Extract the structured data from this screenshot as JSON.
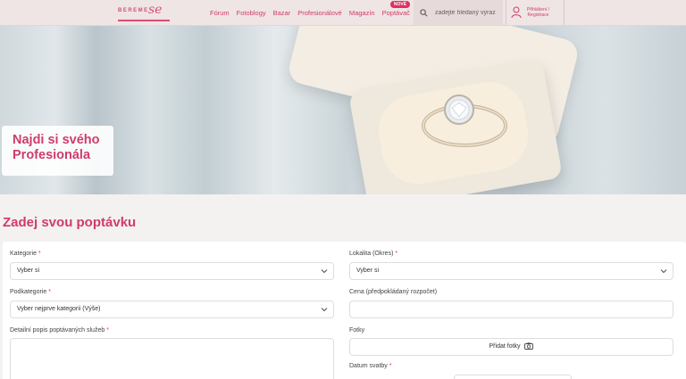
{
  "header": {
    "logo_text": "BEREME",
    "logo_script": "se",
    "nav": [
      "Fórum",
      "Fotoblogy",
      "Bazar",
      "Profesionálové",
      "Magazín",
      "Poptávač"
    ],
    "new_badge": "NOVÉ",
    "search_placeholder": "zadejte hledaný výraz",
    "login_line1": "Přihlášení /",
    "login_line2": "Registrace"
  },
  "hero": {
    "title_line1": "Najdi si svého",
    "title_line2": "Profesionála"
  },
  "form": {
    "title": "Zadej svou poptávku",
    "category": {
      "label": "Kategorie",
      "value": "Vyber si"
    },
    "location": {
      "label": "Lokalita (Okres)",
      "value": "Vyber si"
    },
    "subcategory": {
      "label": "Podkategorie",
      "value": "Vyber nejprve kategorii (Výše)"
    },
    "price": {
      "label": "Cena (předpokládaný rozpočet)",
      "value": ""
    },
    "description": {
      "label": "Detailní popis poptávaných služeb"
    },
    "photos": {
      "label": "Fotky",
      "button": "Přidat fotky"
    },
    "wedding_date": {
      "label": "Datum svatby"
    },
    "required_mark": "*"
  },
  "colors": {
    "accent": "#cf3c6a",
    "badge": "#e0305f"
  },
  "icons": [
    "search-icon",
    "user-icon",
    "chevron-down-icon",
    "camera-icon"
  ]
}
